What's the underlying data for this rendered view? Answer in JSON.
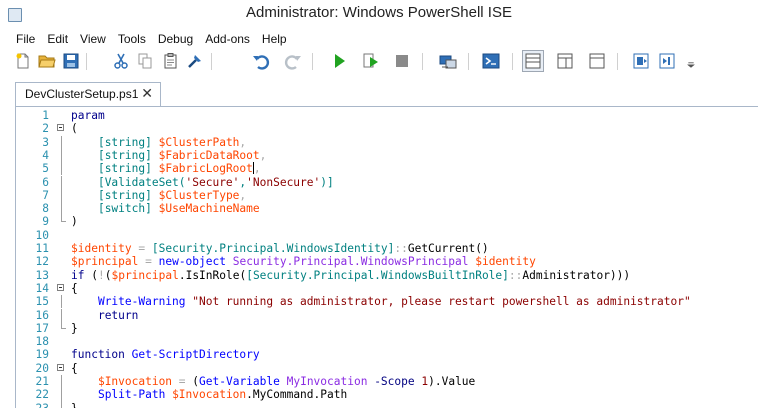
{
  "window": {
    "title": "Administrator: Windows PowerShell ISE"
  },
  "menu": [
    "File",
    "Edit",
    "View",
    "Tools",
    "Debug",
    "Add-ons",
    "Help"
  ],
  "toolbar": {
    "buttons": [
      "new-icon",
      "open-icon",
      "save-icon",
      "cut-icon",
      "copy-icon",
      "paste-icon",
      "clear-icon",
      "undo-icon",
      "redo-icon",
      "run-icon",
      "run-selection-icon",
      "stop-icon",
      "remote-powershell-icon",
      "powershell-console-icon",
      "show-script-top-icon",
      "show-script-right-icon",
      "show-script-max-icon",
      "show-commands-icon",
      "show-addon-icon",
      "customize-icon"
    ]
  },
  "tab": {
    "label": "DevClusterSetup.ps1",
    "close": "✕"
  },
  "code_lines": [
    {
      "n": "1",
      "tokens": [
        [
          "k",
          "param"
        ]
      ]
    },
    {
      "n": "2",
      "fold": "start",
      "tokens": [
        [
          "p",
          "("
        ]
      ]
    },
    {
      "n": "3",
      "fold": "mid",
      "tokens": [
        [
          "p",
          "    "
        ],
        [
          "t",
          "[string]"
        ],
        [
          "p",
          " "
        ],
        [
          "v",
          "$ClusterPath"
        ],
        [
          "o",
          ","
        ]
      ]
    },
    {
      "n": "4",
      "fold": "mid",
      "tokens": [
        [
          "p",
          "    "
        ],
        [
          "t",
          "[string]"
        ],
        [
          "p",
          " "
        ],
        [
          "v",
          "$FabricDataRoot"
        ],
        [
          "o",
          ","
        ]
      ]
    },
    {
      "n": "5",
      "fold": "mid",
      "tokens": [
        [
          "p",
          "    "
        ],
        [
          "t",
          "[string]"
        ],
        [
          "p",
          " "
        ],
        [
          "v",
          "$FabricLogRoot"
        ],
        [
          "caret",
          ""
        ],
        [
          "o",
          ","
        ]
      ]
    },
    {
      "n": "6",
      "fold": "mid",
      "tokens": [
        [
          "p",
          "    "
        ],
        [
          "t",
          "[ValidateSet("
        ],
        [
          "s",
          "'Secure'"
        ],
        [
          "t",
          ","
        ],
        [
          "s",
          "'NonSecure'"
        ],
        [
          "t",
          ")]"
        ]
      ]
    },
    {
      "n": "7",
      "fold": "mid",
      "tokens": [
        [
          "p",
          "    "
        ],
        [
          "t",
          "[string]"
        ],
        [
          "p",
          " "
        ],
        [
          "v",
          "$ClusterType"
        ],
        [
          "o",
          ","
        ]
      ]
    },
    {
      "n": "8",
      "fold": "mid",
      "tokens": [
        [
          "p",
          "    "
        ],
        [
          "t",
          "[switch]"
        ],
        [
          "p",
          " "
        ],
        [
          "v",
          "$UseMachineName"
        ]
      ]
    },
    {
      "n": "9",
      "fold": "end",
      "tokens": [
        [
          "p",
          ")"
        ]
      ]
    },
    {
      "n": "10",
      "tokens": []
    },
    {
      "n": "11",
      "tokens": [
        [
          "v",
          "$identity"
        ],
        [
          "p",
          " "
        ],
        [
          "o",
          "="
        ],
        [
          "p",
          " "
        ],
        [
          "t",
          "[Security.Principal.WindowsIdentity]"
        ],
        [
          "o",
          "::"
        ],
        [
          "p",
          "GetCurrent()"
        ]
      ]
    },
    {
      "n": "12",
      "tokens": [
        [
          "v",
          "$principal"
        ],
        [
          "p",
          " "
        ],
        [
          "o",
          "="
        ],
        [
          "p",
          " "
        ],
        [
          "c",
          "new-object"
        ],
        [
          "p",
          " "
        ],
        [
          "a",
          "Security.Principal.WindowsPrincipal"
        ],
        [
          "p",
          " "
        ],
        [
          "v",
          "$identity"
        ]
      ]
    },
    {
      "n": "13",
      "tokens": [
        [
          "k",
          "if"
        ],
        [
          "p",
          " ("
        ],
        [
          "o",
          "!"
        ],
        [
          "p",
          "("
        ],
        [
          "v",
          "$principal"
        ],
        [
          "p",
          "."
        ],
        [
          "p",
          "IsInRole("
        ],
        [
          "t",
          "[Security.Principal.WindowsBuiltInRole]"
        ],
        [
          "o",
          "::"
        ],
        [
          "p",
          "Administrator)))"
        ]
      ]
    },
    {
      "n": "14",
      "fold": "start",
      "tokens": [
        [
          "p",
          "{"
        ]
      ]
    },
    {
      "n": "15",
      "fold": "mid",
      "tokens": [
        [
          "p",
          "    "
        ],
        [
          "c",
          "Write-Warning"
        ],
        [
          "p",
          " "
        ],
        [
          "s",
          "\"Not running as administrator, please restart powershell as administrator\""
        ]
      ]
    },
    {
      "n": "16",
      "fold": "mid",
      "tokens": [
        [
          "p",
          "    "
        ],
        [
          "k",
          "return"
        ]
      ]
    },
    {
      "n": "17",
      "fold": "end",
      "tokens": [
        [
          "p",
          "}"
        ]
      ]
    },
    {
      "n": "18",
      "tokens": []
    },
    {
      "n": "19",
      "tokens": [
        [
          "k",
          "function"
        ],
        [
          "p",
          " "
        ],
        [
          "c",
          "Get-ScriptDirectory"
        ]
      ]
    },
    {
      "n": "20",
      "fold": "start",
      "tokens": [
        [
          "p",
          "{"
        ]
      ]
    },
    {
      "n": "21",
      "fold": "mid",
      "tokens": [
        [
          "p",
          "    "
        ],
        [
          "v",
          "$Invocation"
        ],
        [
          "p",
          " "
        ],
        [
          "o",
          "="
        ],
        [
          "p",
          " ("
        ],
        [
          "c",
          "Get-Variable"
        ],
        [
          "p",
          " "
        ],
        [
          "a",
          "MyInvocation"
        ],
        [
          "p",
          " "
        ],
        [
          "g",
          "-Scope"
        ],
        [
          "p",
          " "
        ],
        [
          "s",
          "1"
        ],
        [
          "p",
          ")."
        ],
        [
          "p",
          "Value"
        ]
      ]
    },
    {
      "n": "22",
      "fold": "mid",
      "tokens": [
        [
          "p",
          "    "
        ],
        [
          "c",
          "Split-Path"
        ],
        [
          "p",
          " "
        ],
        [
          "v",
          "$Invocation"
        ],
        [
          "p",
          "."
        ],
        [
          "p",
          "MyCommand"
        ],
        [
          "p",
          "."
        ],
        [
          "p",
          "Path"
        ]
      ]
    },
    {
      "n": "23",
      "fold": "end",
      "tokens": [
        [
          "p",
          "}"
        ]
      ]
    }
  ]
}
